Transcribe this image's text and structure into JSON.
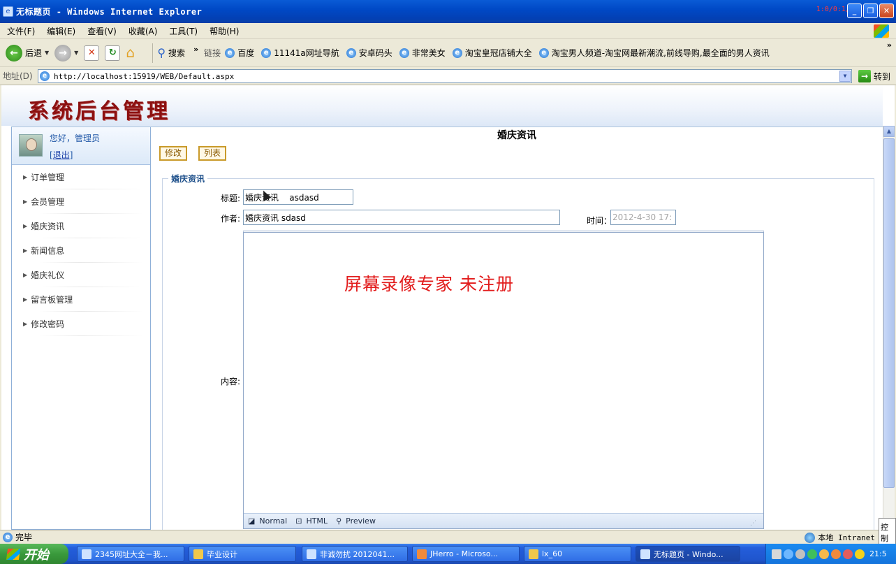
{
  "window": {
    "title": "无标题页 - Windows Internet Explorer",
    "recording_badge": "1:0/0:1/0"
  },
  "menubar": [
    "文件(F)",
    "编辑(E)",
    "查看(V)",
    "收藏(A)",
    "工具(T)",
    "帮助(H)"
  ],
  "toolbar": {
    "back_label": "后退",
    "search_label": "搜索",
    "links_label": "链接",
    "links": [
      "百度",
      "11141a网址导航",
      "安卓码头",
      "非常美女",
      "淘宝皇冠店铺大全",
      "淘宝男人频道-淘宝网最新潮流,前线导购,最全面的男人资讯"
    ]
  },
  "address": {
    "label": "地址(D)",
    "url": "http://localhost:15919/WEB/Default.aspx",
    "go_label": "转到"
  },
  "site": {
    "logo": "系统后台管理",
    "greeting": "您好，管理员",
    "logout_prefix": "[",
    "logout": "退出",
    "logout_suffix": "]"
  },
  "sidebar": {
    "items": [
      {
        "label": "订单管理"
      },
      {
        "label": "会员管理"
      },
      {
        "label": "婚庆资讯"
      },
      {
        "label": "新闻信息"
      },
      {
        "label": "婚庆礼仪"
      },
      {
        "label": "留言板管理"
      },
      {
        "label": "修改密码"
      }
    ]
  },
  "main": {
    "title": "婚庆资讯",
    "edit_button": "修改",
    "list_button": "列表",
    "fieldset_legend": "婚庆资讯",
    "title_label": "标题:",
    "title_value": "婚庆资讯    asdasd",
    "author_label": "作者:",
    "author_value": "婚庆资讯 sdasd",
    "time_label": "时间：",
    "time_value": "2012-4-30 17:",
    "content_label": "内容:",
    "watermark": "屏幕录像专家  未注册",
    "editor_modes": [
      "Normal",
      "HTML",
      "Preview"
    ]
  },
  "statusbar": {
    "status": "完毕",
    "zone": "本地 Intranet",
    "popup_hint": "控制"
  },
  "taskbar": {
    "start": "开始",
    "tasks": [
      "2345网址大全－我...",
      "毕业设计",
      "非诚勿扰 2012041...",
      "JHerro - Microso...",
      "lx_60",
      "无标题页 - Windo..."
    ],
    "clock": "21:5"
  }
}
